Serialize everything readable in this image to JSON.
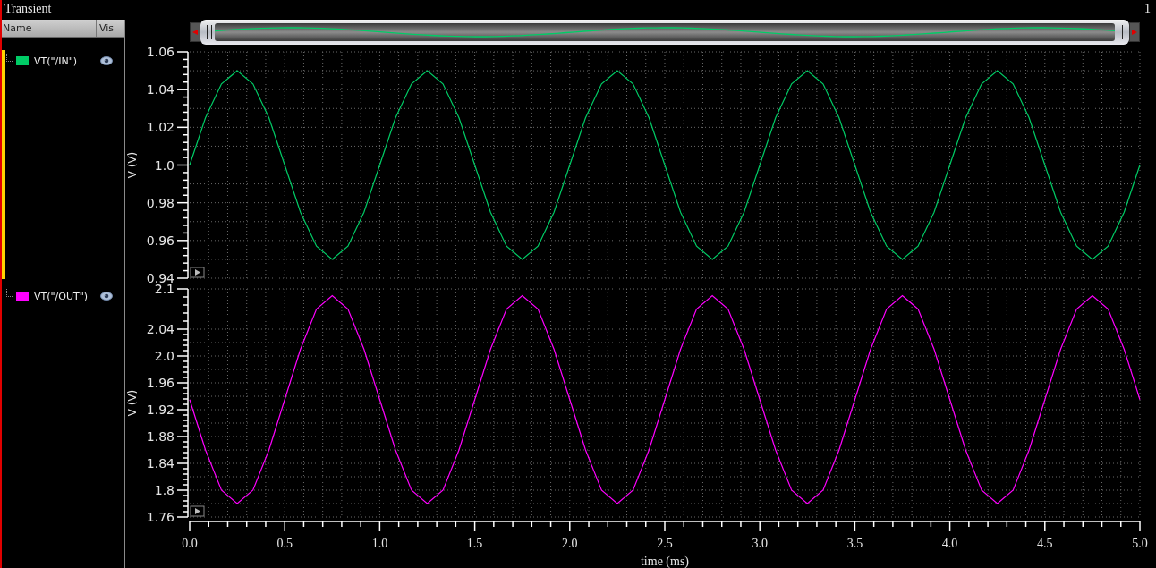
{
  "window": {
    "title": "Transient",
    "page_number": "1"
  },
  "browser": {
    "columns": [
      "Name",
      "Vis"
    ]
  },
  "plots": [
    {
      "signal": {
        "name": "VT(\"/IN\")",
        "color": "#00cc66",
        "visible": true,
        "selected": true
      },
      "chart_data": {
        "type": "line",
        "grid": true,
        "ylabel": "V (V)",
        "xlim": [
          0,
          5
        ],
        "ylim": [
          0.94,
          1.06
        ],
        "yticks": [
          {
            "value": 0.94,
            "label": "0.94"
          },
          {
            "value": 0.96,
            "label": "0.96"
          },
          {
            "value": 0.98,
            "label": "0.98"
          },
          {
            "value": 1.0,
            "label": "1.0"
          },
          {
            "value": 1.02,
            "label": "1.02"
          },
          {
            "value": 1.04,
            "label": "1.04"
          },
          {
            "value": 1.06,
            "label": "1.06"
          }
        ],
        "x": [
          0,
          0.083,
          0.167,
          0.25,
          0.333,
          0.417,
          0.5,
          0.583,
          0.667,
          0.75,
          0.833,
          0.917,
          1,
          1.083,
          1.167,
          1.25,
          1.333,
          1.417,
          1.5,
          1.583,
          1.667,
          1.75,
          1.833,
          1.917,
          2,
          2.083,
          2.167,
          2.25,
          2.333,
          2.417,
          2.5,
          2.583,
          2.667,
          2.75,
          2.833,
          2.917,
          3,
          3.083,
          3.167,
          3.25,
          3.333,
          3.417,
          3.5,
          3.583,
          3.667,
          3.75,
          3.833,
          3.917,
          4,
          4.083,
          4.167,
          4.25,
          4.333,
          4.417,
          4.5,
          4.583,
          4.667,
          4.75,
          4.833,
          4.917,
          5
        ],
        "series": [
          {
            "color": "#00cc66",
            "values": [
              1,
              1.025,
              1.043,
              1.05,
              1.043,
              1.025,
              1,
              0.975,
              0.957,
              0.95,
              0.957,
              0.975,
              1,
              1.025,
              1.043,
              1.05,
              1.043,
              1.025,
              1,
              0.975,
              0.957,
              0.95,
              0.957,
              0.975,
              1,
              1.025,
              1.043,
              1.05,
              1.043,
              1.025,
              1,
              0.975,
              0.957,
              0.95,
              0.957,
              0.975,
              1,
              1.025,
              1.043,
              1.05,
              1.043,
              1.025,
              1,
              0.975,
              0.957,
              0.95,
              0.957,
              0.975,
              1,
              1.025,
              1.043,
              1.05,
              1.043,
              1.025,
              1,
              0.975,
              0.957,
              0.95,
              0.957,
              0.975,
              1
            ]
          }
        ]
      }
    },
    {
      "signal": {
        "name": "VT(\"/OUT\")",
        "color": "#ff00ff",
        "visible": true,
        "selected": false
      },
      "chart_data": {
        "type": "line",
        "grid": true,
        "xlabel": "time (ms)",
        "ylabel": "V (V)",
        "xlim": [
          0,
          5
        ],
        "ylim": [
          1.76,
          2.1
        ],
        "xticks": [
          {
            "value": 0,
            "label": "0.0"
          },
          {
            "value": 0.5,
            "label": "0.5"
          },
          {
            "value": 1,
            "label": "1.0"
          },
          {
            "value": 1.5,
            "label": "1.5"
          },
          {
            "value": 2,
            "label": "2.0"
          },
          {
            "value": 2.5,
            "label": "2.5"
          },
          {
            "value": 3,
            "label": "3.0"
          },
          {
            "value": 3.5,
            "label": "3.5"
          },
          {
            "value": 4,
            "label": "4.0"
          },
          {
            "value": 4.5,
            "label": "4.5"
          },
          {
            "value": 5,
            "label": "5.0"
          }
        ],
        "yticks": [
          {
            "value": 1.76,
            "label": "1.76"
          },
          {
            "value": 1.8,
            "label": "1.8"
          },
          {
            "value": 1.84,
            "label": "1.84"
          },
          {
            "value": 1.88,
            "label": "1.88"
          },
          {
            "value": 1.92,
            "label": "1.92"
          },
          {
            "value": 1.96,
            "label": "1.96"
          },
          {
            "value": 2.0,
            "label": "2.0"
          },
          {
            "value": 2.04,
            "label": "2.04"
          },
          {
            "value": 2.1,
            "label": "2.1"
          }
        ],
        "x": [
          0,
          0.083,
          0.167,
          0.25,
          0.333,
          0.417,
          0.5,
          0.583,
          0.667,
          0.75,
          0.833,
          0.917,
          1,
          1.083,
          1.167,
          1.25,
          1.333,
          1.417,
          1.5,
          1.583,
          1.667,
          1.75,
          1.833,
          1.917,
          2,
          2.083,
          2.167,
          2.25,
          2.333,
          2.417,
          2.5,
          2.583,
          2.667,
          2.75,
          2.833,
          2.917,
          3,
          3.083,
          3.167,
          3.25,
          3.333,
          3.417,
          3.5,
          3.583,
          3.667,
          3.75,
          3.833,
          3.917,
          4,
          4.083,
          4.167,
          4.25,
          4.333,
          4.417,
          4.5,
          4.583,
          4.667,
          4.75,
          4.833,
          4.917,
          5
        ],
        "series": [
          {
            "color": "#ff00ff",
            "values": [
              1.935,
              1.86,
              1.8,
              1.78,
              1.8,
              1.86,
              1.935,
              2.01,
              2.07,
              2.09,
              2.07,
              2.01,
              1.935,
              1.86,
              1.8,
              1.78,
              1.8,
              1.86,
              1.935,
              2.01,
              2.07,
              2.09,
              2.07,
              2.01,
              1.935,
              1.86,
              1.8,
              1.78,
              1.8,
              1.86,
              1.935,
              2.01,
              2.07,
              2.09,
              2.07,
              2.01,
              1.935,
              1.86,
              1.8,
              1.78,
              1.8,
              1.86,
              1.935,
              2.01,
              2.07,
              2.09,
              2.07,
              2.01,
              1.935,
              1.86,
              1.8,
              1.78,
              1.8,
              1.86,
              1.935,
              2.01,
              2.07,
              2.09,
              2.07,
              2.01,
              1.935
            ]
          }
        ]
      }
    }
  ]
}
